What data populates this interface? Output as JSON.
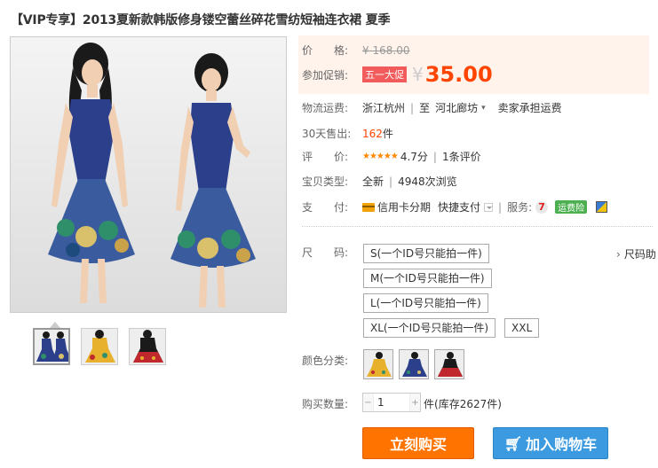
{
  "title": "【VIP专享】2013夏新款韩版修身镂空蕾丝碎花雪纺短袖连衣裙 夏季",
  "price": {
    "label": "价　　格:",
    "yen": "¥",
    "original": "168.00"
  },
  "promo": {
    "label": "参加促销:",
    "tag": "五一大促",
    "yen": "¥",
    "value": "35.00"
  },
  "shipping": {
    "label": "物流运费:",
    "from": "浙江杭州",
    "to_text": "至",
    "dest": "河北廊坊",
    "fee": "卖家承担运费"
  },
  "sales": {
    "label": "30天售出:",
    "count": "162",
    "unit": "件"
  },
  "rating": {
    "label": "评　　价:",
    "stars": "★★★★★",
    "score": "4.7分",
    "reviews": "1条评价"
  },
  "condition": {
    "label": "宝贝类型:",
    "type": "全新",
    "views": "4948次浏览"
  },
  "payment": {
    "label": "支　　付:",
    "option": "信用卡分期",
    "option2": "快捷支付",
    "service_label": "服务:",
    "insure": "运费险"
  },
  "size": {
    "label": "尺　　码:",
    "options": [
      "S(一个ID号只能拍一件)",
      "M(一个ID号只能拍一件)",
      "L(一个ID号只能拍一件)",
      "XL(一个ID号只能拍一件)",
      "XXL"
    ],
    "chart_link": "尺码助"
  },
  "color": {
    "label": "颜色分类:"
  },
  "quantity": {
    "label": "购买数量:",
    "value": "1",
    "unit": "件",
    "stock": "(库存2627件)"
  },
  "actions": {
    "buy": "立刻购买",
    "cart": "加入购物车"
  },
  "colors": {
    "accent": "#ff4400",
    "buy": "#ff7300",
    "cart": "#3c9be0",
    "dress_blue": "#2b3f8a",
    "dress_yellow": "#e7b12e",
    "dress_red": "#c0282d"
  }
}
